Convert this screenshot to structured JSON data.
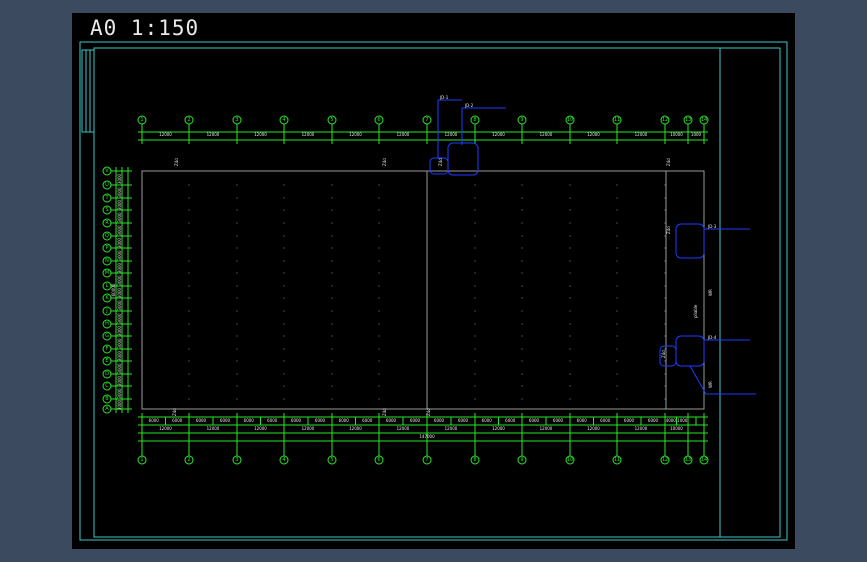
{
  "drawing": {
    "title": "A0 1:150",
    "axes_top": [
      "1",
      "2",
      "3",
      "4",
      "5",
      "6",
      "7",
      "8",
      "9",
      "10",
      "11",
      "12",
      "13",
      "14"
    ],
    "axes_bottom": [
      "1",
      "2",
      "3",
      "4",
      "5",
      "6",
      "7",
      "8",
      "9",
      "10",
      "11",
      "12",
      "13",
      "14"
    ],
    "axes_left": [
      "A",
      "B",
      "C",
      "D",
      "E",
      "F",
      "G",
      "H",
      "J",
      "K",
      "L",
      "M",
      "N",
      "P",
      "Q",
      "R",
      "S",
      "T",
      "U",
      "V"
    ],
    "top_bay_dims": [
      "12000",
      "12000",
      "12000",
      "12000",
      "12000",
      "12000",
      "12000",
      "12000",
      "12000",
      "12000",
      "12000",
      "10000",
      "1000"
    ],
    "bottom_sub_dims": [
      "6000",
      "6000",
      "6000",
      "6000",
      "6000",
      "6000",
      "6000",
      "6000",
      "6000",
      "6000",
      "6000",
      "6000",
      "6000",
      "6000",
      "6000",
      "6000",
      "6000",
      "6000",
      "6000",
      "6000",
      "6000",
      "6000",
      "4000",
      "1000"
    ],
    "bottom_bay_dims": [
      "12000",
      "12000",
      "12000",
      "12000",
      "12000",
      "12000",
      "12000",
      "12000",
      "12000",
      "12000",
      "12000",
      "10000"
    ],
    "overall_dim": "147000",
    "left_row_dims": [
      "3000",
      "3000",
      "3000",
      "3000",
      "3000",
      "3000",
      "3000",
      "3000",
      "3000",
      "3000",
      "3000",
      "3000",
      "3000",
      "3000",
      "3000",
      "3000",
      "3000",
      "3000",
      "3000"
    ],
    "left_overall_dim": "60000",
    "column_marks": [
      "Z4d",
      "Z4d",
      "Z4d",
      "Z4d",
      "Z4d",
      "Z4d",
      "Z4d",
      "Z4d",
      "Z4d"
    ],
    "right_side_label": "pliable",
    "right_side_note": "WR",
    "callouts": [
      "JD-1",
      "JD-2",
      "JD-3",
      "JD-4"
    ]
  },
  "colors": {
    "background": "#3b4a5e",
    "paper": "#000000",
    "frame": "#3ec7c7",
    "axis": "#27e827",
    "outline": "#9a9a9a",
    "callout": "#1e3cff"
  }
}
